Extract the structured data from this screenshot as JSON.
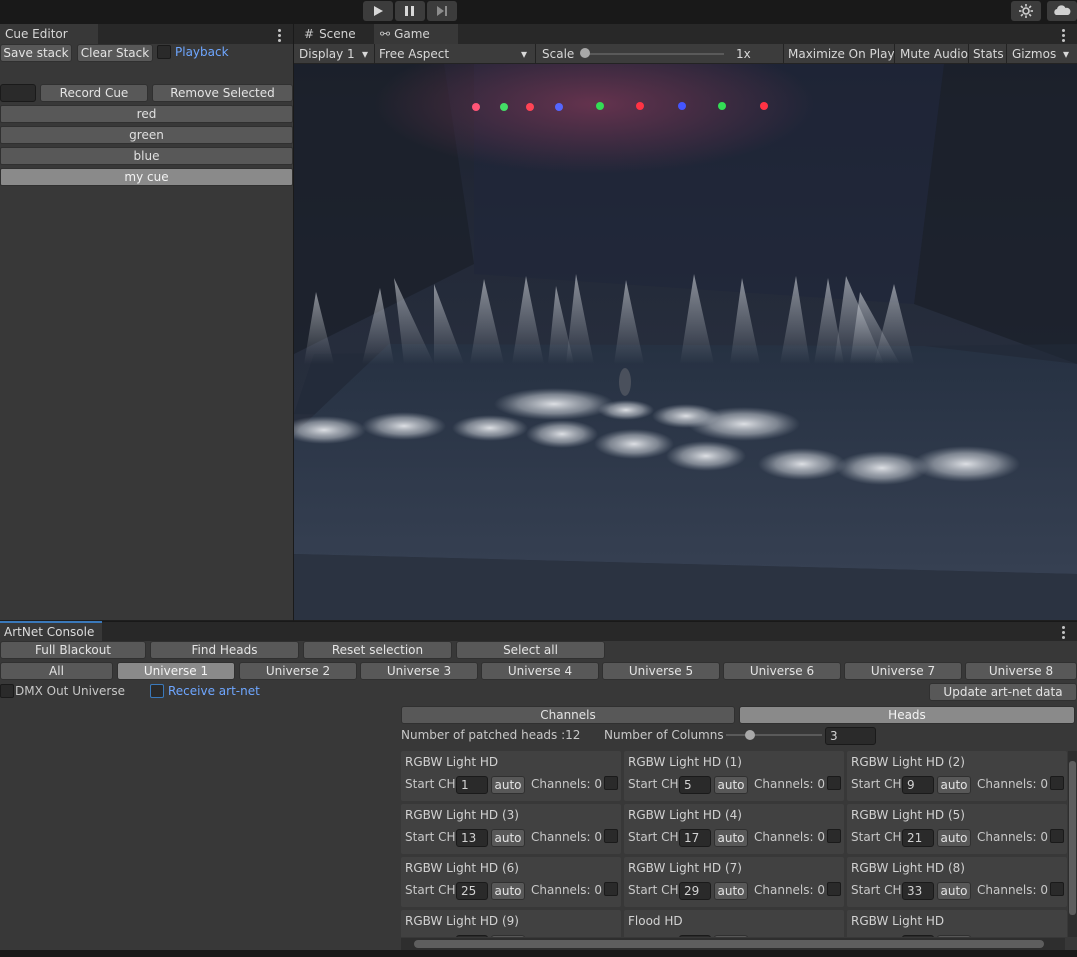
{
  "toolbar": {
    "play_icon": "play-icon",
    "pause_icon": "pause-icon",
    "step_icon": "step-icon",
    "settings_icon": "settings-icon",
    "cloud_icon": "cloud-icon"
  },
  "cue_editor": {
    "tab_title": "Cue Editor",
    "save_stack": "Save stack",
    "clear_stack": "Clear Stack",
    "playback_label": "Playback",
    "name_value": "",
    "record_cue": "Record Cue",
    "remove_selected": "Remove Selected",
    "cues": [
      {
        "name": "red",
        "selected": false
      },
      {
        "name": "green",
        "selected": false
      },
      {
        "name": "blue",
        "selected": false
      },
      {
        "name": "my cue",
        "selected": true
      }
    ]
  },
  "game_view": {
    "tab_scene": "Scene",
    "tab_game": "Game",
    "display": "Display 1",
    "aspect": "Free Aspect",
    "scale_label": "Scale",
    "scale_value": "1x",
    "scale_level": 0,
    "maximize": "Maximize On Play",
    "mute": "Mute Audio",
    "stats": "Stats",
    "gizmos": "Gizmos"
  },
  "artnet": {
    "tab_title": "ArtNet Console",
    "full_blackout": "Full Blackout",
    "find_heads": "Find Heads",
    "reset_selection": "Reset selection",
    "select_all": "Select all",
    "universes": [
      "All",
      "Universe 1",
      "Universe 2",
      "Universe 3",
      "Universe 4",
      "Universe 5",
      "Universe 6",
      "Universe 7",
      "Universe 8"
    ],
    "active_universe": "Universe 1",
    "dmx_out": "DMX Out Universe",
    "receive": "Receive art-net",
    "update": "Update art-net data",
    "view_channels": "Channels",
    "view_heads": "Heads",
    "patched_heads": "Number of patched heads :12",
    "columns_label": "Number of Columns",
    "columns_value": "3",
    "start_label": "Start CH",
    "auto_label": "auto",
    "channels_label": "Channels: 0",
    "heads": [
      {
        "name": "RGBW Light HD",
        "start": "1"
      },
      {
        "name": "RGBW Light HD (1)",
        "start": "5"
      },
      {
        "name": "RGBW Light HD (2)",
        "start": "9"
      },
      {
        "name": "RGBW Light HD (3)",
        "start": "13"
      },
      {
        "name": "RGBW Light HD (4)",
        "start": "17"
      },
      {
        "name": "RGBW Light HD (5)",
        "start": "21"
      },
      {
        "name": "RGBW Light HD (6)",
        "start": "25"
      },
      {
        "name": "RGBW Light HD (7)",
        "start": "29"
      },
      {
        "name": "RGBW Light HD (8)",
        "start": "33"
      },
      {
        "name": "RGBW Light HD (9)",
        "start": ""
      },
      {
        "name": "Flood HD",
        "start": ""
      },
      {
        "name": "RGBW Light HD",
        "start": ""
      }
    ]
  },
  "colors": {
    "accent": "#3a79bb",
    "link": "#6ea6ff",
    "button": "#585858",
    "button_active": "#8a8a8a",
    "panel": "#383838"
  }
}
